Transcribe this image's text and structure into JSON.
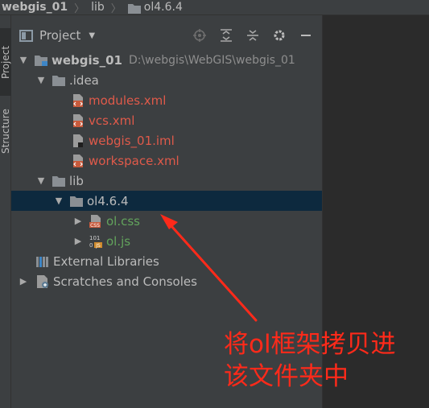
{
  "breadcrumb": {
    "items": [
      "webgis_01",
      "lib",
      "ol4.6.4"
    ]
  },
  "side_strip": {
    "tabs": [
      "Project",
      "Structure"
    ]
  },
  "panel": {
    "title": "Project",
    "tools": [
      "locate-icon",
      "expand-all-icon",
      "collapse-all-icon",
      "gear-icon",
      "minimize-icon"
    ]
  },
  "tree": {
    "root_label": "webgis_01",
    "root_path": "D:\\webgis\\WebGIS\\webgis_01",
    "idea_label": ".idea",
    "modules_label": "modules.xml",
    "vcs_label": "vcs.xml",
    "iml_label": "webgis_01.iml",
    "workspace_label": "workspace.xml",
    "lib_label": "lib",
    "ol_folder_label": "ol4.6.4",
    "olcss_label": "ol.css",
    "oljs_label": "ol.js",
    "ext_libs_label": "External Libraries",
    "scratches_label": "Scratches and Consoles"
  },
  "annotation": {
    "line1": "将ol框架拷贝进",
    "line2": "该文件夹中"
  },
  "colors": {
    "background": "#3c3f41",
    "editor": "#2b2b2b",
    "selection": "#0d293e",
    "modified_red": "#e05a4a",
    "added_green": "#62a35c",
    "annotation_red": "#ff2a1a"
  }
}
